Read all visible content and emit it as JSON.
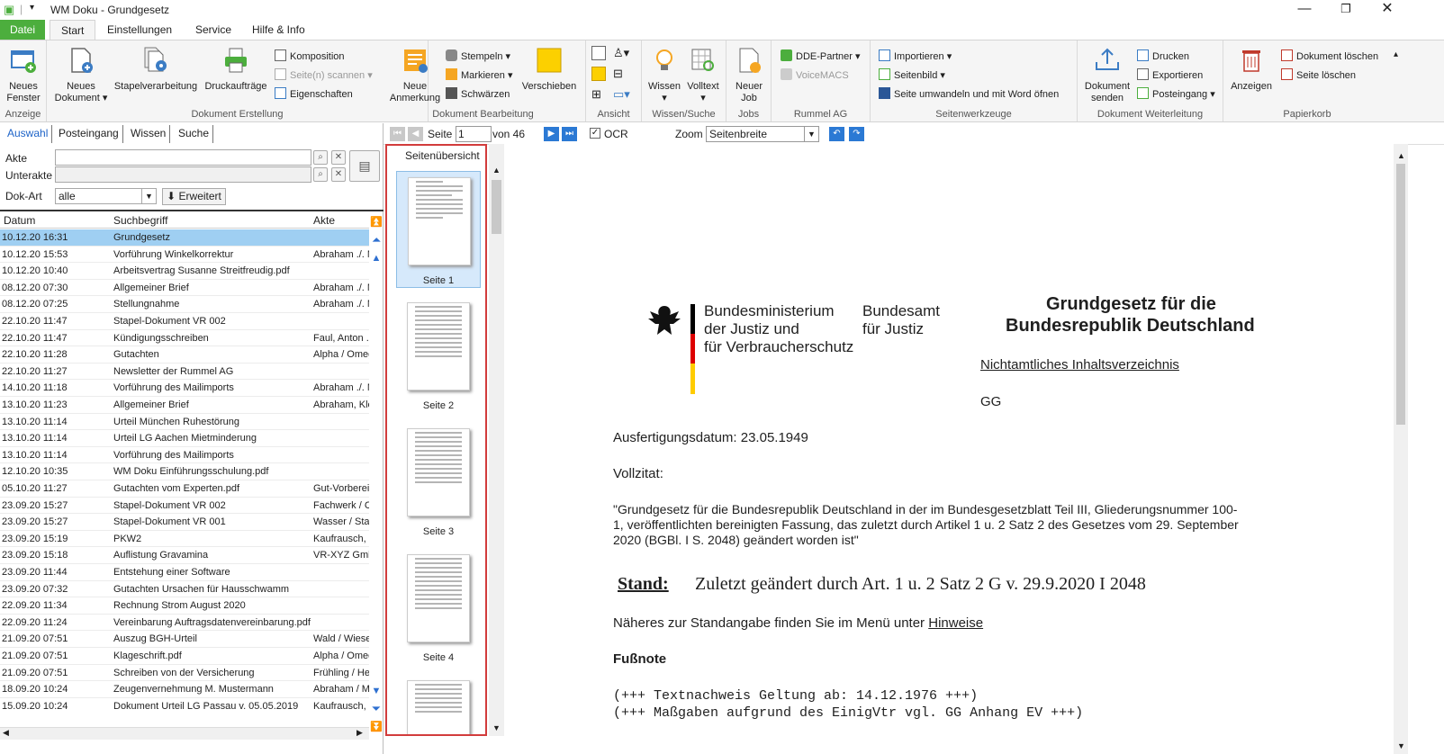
{
  "window": {
    "title": "WM Doku - Grundgesetz"
  },
  "menu": {
    "tabs": [
      "Datei",
      "Start",
      "Einstellungen",
      "Service",
      "Hilfe & Info"
    ]
  },
  "ribbon": {
    "groups": {
      "anzeige": "Anzeige",
      "erstellung": "Dokument Erstellung",
      "bearbeitung": "Dokument Bearbeitung",
      "ansicht": "Ansicht",
      "wissen": "Wissen/Suche",
      "jobs": "Jobs",
      "rummel": "Rummel AG",
      "seitenwerkzeuge": "Seitenwerkzeuge",
      "weiterleitung": "Dokument Weiterleitung",
      "papierkorb": "Papierkorb"
    },
    "buttons": {
      "neues_fenster": [
        "Neues",
        "Fenster"
      ],
      "neues_dokument": [
        "Neues",
        "Dokument ▾"
      ],
      "stapelverarbeitung": "Stapelverarbeitung",
      "druckauftraege": "Druckaufträge",
      "komposition": "Komposition",
      "seiten_scannen": "Seite(n) scannen ▾",
      "eigenschaften": "Eigenschaften",
      "neue_anmerkung": [
        "Neue",
        "Anmerkung"
      ],
      "stempeln": "Stempeln ▾",
      "markieren": "Markieren ▾",
      "schwaerzen": "Schwärzen",
      "verschieben": "Verschieben",
      "wissen": [
        "Wissen",
        "▾"
      ],
      "volltext": [
        "Volltext",
        "▾"
      ],
      "neuer_job": [
        "Neuer",
        "Job"
      ],
      "dde_partner": "DDE-Partner ▾",
      "voicemacs": "VoiceMACS",
      "importieren": "Importieren ▾",
      "seitenbild": "Seitenbild ▾",
      "seite_umwandeln": "Seite umwandeln und mit Word öfnen",
      "dokument_senden": [
        "Dokument",
        "senden"
      ],
      "drucken": "Drucken",
      "exportieren": "Exportieren",
      "posteingang": "Posteingang ▾",
      "anzeigen": "Anzeigen",
      "dokument_loeschen": "Dokument löschen",
      "seite_loeschen": "Seite löschen"
    }
  },
  "left": {
    "tabs": [
      "Auswahl",
      "Posteingang",
      "Wissen",
      "Suche"
    ],
    "akte_label": "Akte",
    "unterakte_label": "Unterakte",
    "dokart_label": "Dok-Art",
    "dokart_value": "alle",
    "erweitert": "Erweitert",
    "columns": [
      "Datum",
      "Suchbegriff",
      "Akte"
    ],
    "rows": [
      [
        "10.12.20 16:31",
        "Grundgesetz",
        ""
      ],
      [
        "10.12.20 15:53",
        "Vorführung Winkelkorrektur",
        "Abraham ./. M"
      ],
      [
        "10.12.20 10:40",
        "Arbeitsvertrag Susanne Streitfreudig.pdf",
        ""
      ],
      [
        "08.12.20 07:30",
        "Allgemeiner Brief",
        "Abraham ./. M"
      ],
      [
        "08.12.20 07:25",
        "Stellungnahme",
        "Abraham ./. M"
      ],
      [
        "22.10.20 11:47",
        "Stapel-Dokument VR 002",
        ""
      ],
      [
        "22.10.20 11:47",
        "Kündigungsschreiben",
        "Faul, Anton ..."
      ],
      [
        "22.10.20 11:28",
        "Gutachten",
        "Alpha / Omeg"
      ],
      [
        "22.10.20 11:27",
        "Newsletter der Rummel AG",
        ""
      ],
      [
        "14.10.20 11:18",
        "Vorführung des Mailimports",
        "Abraham ./. M"
      ],
      [
        "13.10.20 11:23",
        "Allgemeiner Brief",
        "Abraham, Kle"
      ],
      [
        "13.10.20 11:14",
        "Urteil München Ruhestörung",
        ""
      ],
      [
        "13.10.20 11:14",
        "Urteil LG Aachen Mietminderung",
        ""
      ],
      [
        "13.10.20 11:14",
        "Vorführung des Mailimports",
        ""
      ],
      [
        "12.10.20 10:35",
        "WM Doku Einführungsschulung.pdf",
        ""
      ],
      [
        "05.10.20 11:27",
        "Gutachten vom Experten.pdf",
        "Gut-Vorberei"
      ],
      [
        "23.09.20 15:27",
        "Stapel-Dokument VR 002",
        "Fachwerk / C"
      ],
      [
        "23.09.20 15:27",
        "Stapel-Dokument VR 001",
        "Wasser / Sta"
      ],
      [
        "23.09.20 15:19",
        "PKW2",
        "Kaufrausch,"
      ],
      [
        "23.09.20 15:18",
        "Auflistung Gravamina",
        "VR-XYZ Gmb"
      ],
      [
        "23.09.20 11:44",
        "Entstehung einer Software",
        ""
      ],
      [
        "23.09.20 07:32",
        "Gutachten Ursachen für Hausschwamm",
        ""
      ],
      [
        "22.09.20 11:34",
        "Rechnung Strom August 2020",
        ""
      ],
      [
        "22.09.20 11:24",
        "Vereinbarung Auftragsdatenvereinbarung.pdf",
        ""
      ],
      [
        "21.09.20 07:51",
        "Auszug BGH-Urteil",
        "Wald / Wiese"
      ],
      [
        "21.09.20 07:51",
        "Klageschrift.pdf",
        "Alpha / Omeg"
      ],
      [
        "21.09.20 07:51",
        "Schreiben von der Versicherung",
        "Frühling / Her"
      ],
      [
        "18.09.20 10:24",
        "Zeugenvernehmung M. Mustermann",
        "Abraham / M"
      ],
      [
        "15.09.20 10:24",
        "Dokument Urteil LG Passau v. 05.05.2019",
        "Kaufrausch,"
      ]
    ]
  },
  "docbar": {
    "seite_label": "Seite",
    "seite_value": "1",
    "von": "von 46",
    "ocr": "OCR",
    "zoom_label": "Zoom",
    "zoom_value": "Seitenbreite"
  },
  "thumbs": {
    "title": "Seitenübersicht",
    "pages": [
      "Seite 1",
      "Seite 2",
      "Seite 3",
      "Seite 4"
    ]
  },
  "document": {
    "ministry": [
      "Bundesministerium",
      "der Justiz und",
      "für Verbraucherschutz"
    ],
    "amt": [
      "Bundesamt",
      "für Justiz"
    ],
    "title": [
      "Grundgesetz für die",
      "Bundesrepublik Deutschland"
    ],
    "toc_link": "Nichtamtliches Inhaltsverzeichnis",
    "gg": "GG",
    "ausfertigung": "Ausfertigungsdatum: 23.05.1949",
    "vollzitat_label": "Vollzitat:",
    "vollzitat": [
      "\"Grundgesetz für die Bundesrepublik Deutschland in der im Bundesgesetzblatt Teil III, Gliederungsnummer 100-",
      "1, veröffentlichten bereinigten Fassung, das zuletzt durch Artikel 1 u. 2 Satz 2 des Gesetzes vom 29. September",
      "2020 (BGBl. I S. 2048) geändert worden ist\""
    ],
    "stand_label": "Stand:",
    "stand_text": "Zuletzt geändert durch Art. 1 u. 2 Satz 2 G v. 29.9.2020 I 2048",
    "naeheres": "Näheres zur Standangabe finden Sie im Menü unter",
    "hinweise": "Hinweise",
    "fussnote": "Fußnote",
    "mono": [
      "(+++ Textnachweis Geltung ab: 14.12.1976 +++)",
      "(+++ Maßgaben aufgrund des EinigVtr vgl. GG Anhang EV +++)"
    ]
  },
  "colors": {
    "file_tab": "#4cae3d",
    "selection": "#9fcff2",
    "accent": "#2b79d4",
    "thumb_border": "#d23c3c"
  }
}
